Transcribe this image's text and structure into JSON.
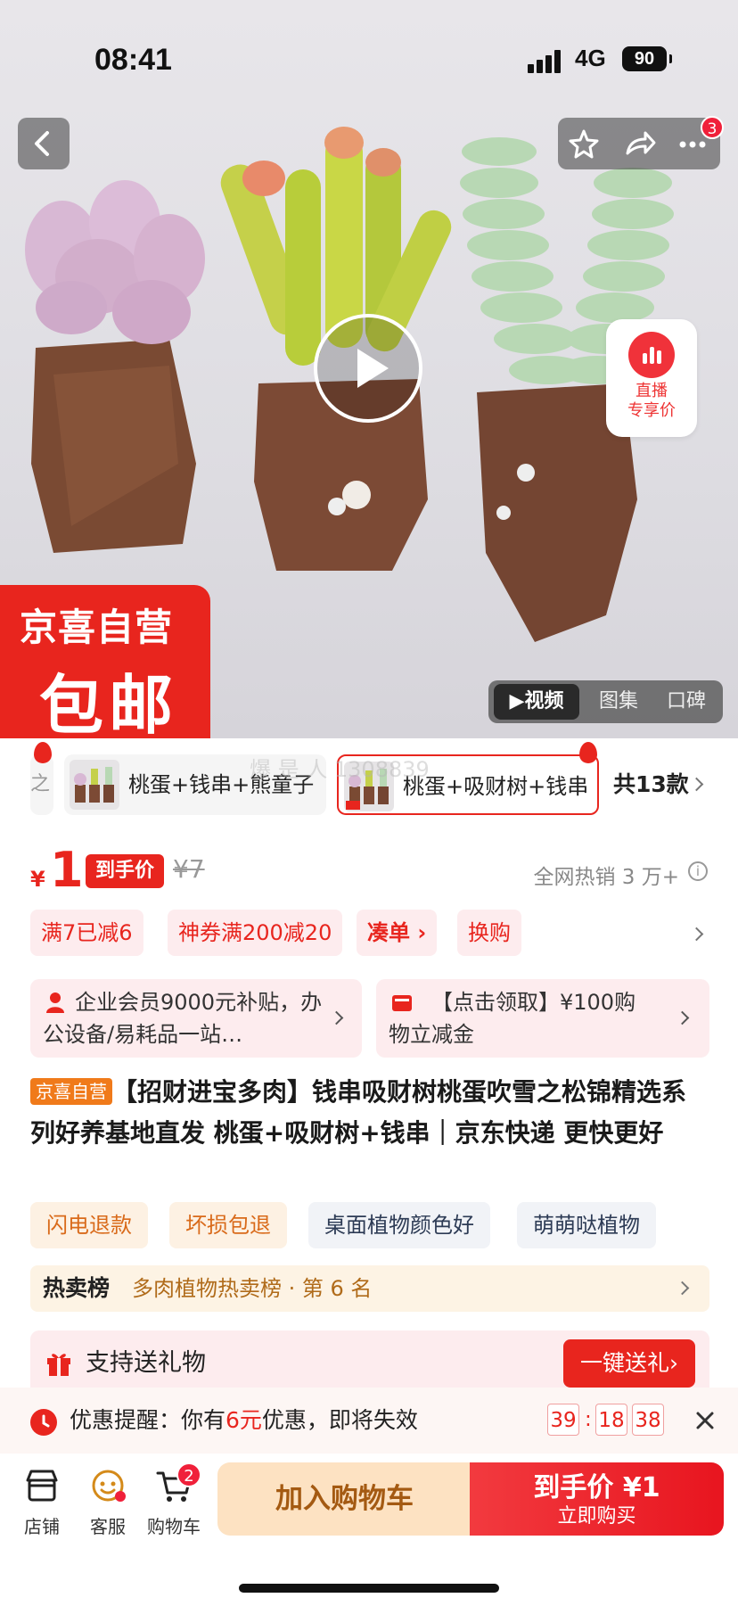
{
  "status_bar": {
    "time": "08:41",
    "network": "4G",
    "battery": "90"
  },
  "top_bar": {
    "notification_count": "3"
  },
  "live": {
    "line1": "直播",
    "line2": "专享价"
  },
  "promo": {
    "line1": "京喜自营",
    "line2": "包邮"
  },
  "video_tabs": [
    "▶视频",
    "图集",
    "口碑"
  ],
  "skus": {
    "partial": "之",
    "items": [
      {
        "name": "桃蛋+钱串+熊童子"
      },
      {
        "name": "桃蛋+吸财树+钱串",
        "selected": true
      }
    ],
    "total": "共13款"
  },
  "watermark": "爆 是 人 1308839",
  "price": {
    "currency": "¥",
    "value": "1",
    "tag": "到手价",
    "original": "¥7",
    "sold": "全网热销 3 万+"
  },
  "coupons": [
    "满7已减6",
    "神券满200减20",
    "凑单 ›",
    "换购"
  ],
  "cards": [
    {
      "text": "企业会员9000元补贴，办公设备/易耗品一站…"
    },
    {
      "text": "【点击领取】¥100购物立减金"
    }
  ],
  "title": {
    "tag": "京喜自营",
    "text": "【招财进宝多肉】钱串吸财树桃蛋吹雪之松锦精选系列好养基地直发 桃蛋+吸财树+钱串｜京东快递 更快更好"
  },
  "services": [
    "闪电退款",
    "坏损包退",
    "桌面植物颜色好",
    "萌萌哒植物"
  ],
  "rank": {
    "label": "热卖榜",
    "text": "多肉植物热卖榜 · 第 6 名"
  },
  "gift": {
    "label": "支持送礼物",
    "button": "一键送礼›"
  },
  "notice": {
    "prefix": "优惠提醒：你有",
    "amount": "6元",
    "suffix": "优惠，即将失效",
    "countdown": [
      "39",
      "18",
      "38"
    ]
  },
  "bottom": {
    "shop": "店铺",
    "service": "客服",
    "cart": "购物车",
    "cart_count": "2",
    "add_cart": "加入购物车",
    "buy_line1": "到手价 ¥1",
    "buy_line2": "立即购买"
  },
  "colors": {
    "accent": "#e8251e",
    "brand_orange": "#f07a1a"
  }
}
